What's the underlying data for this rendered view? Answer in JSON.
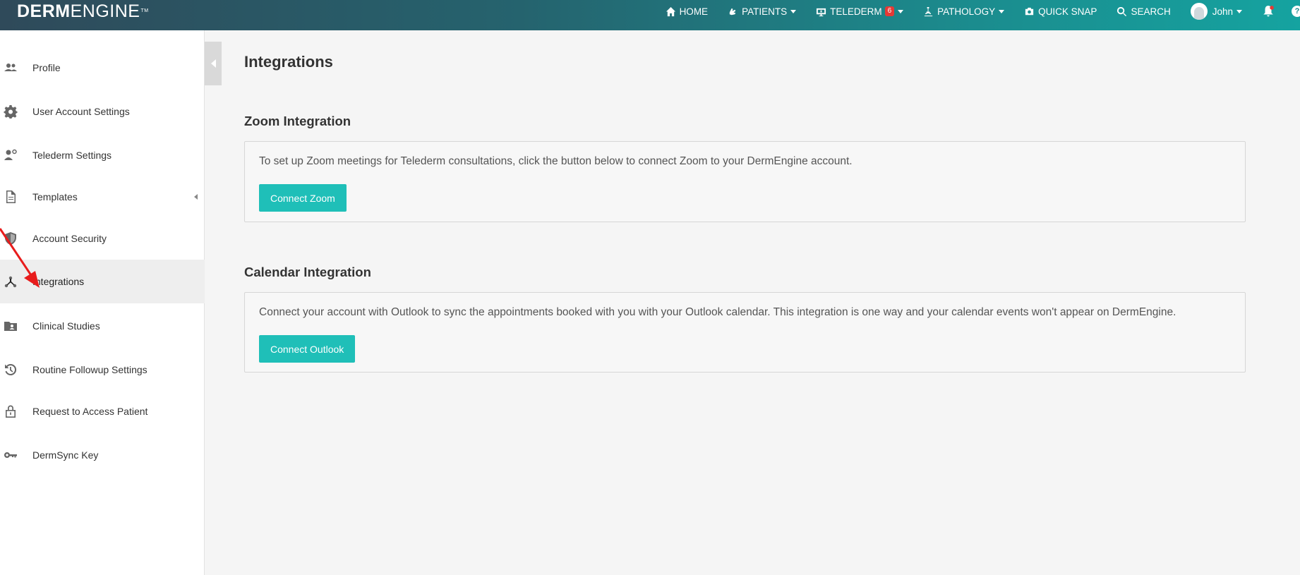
{
  "app": {
    "logo_bold": "DERM",
    "logo_light": "ENGINE",
    "logo_tm": "TM"
  },
  "nav": {
    "home": "HOME",
    "patients": "PATIENTS",
    "telederm": "TELEDERM",
    "telederm_badge": "6",
    "pathology": "PATHOLOGY",
    "quick_snap": "QUICK SNAP",
    "search": "SEARCH",
    "user": "John",
    "help": "?"
  },
  "sidebar": {
    "items": [
      {
        "label": "Profile",
        "icon": "people-icon"
      },
      {
        "label": "User Account Settings",
        "icon": "gear-icon"
      },
      {
        "label": "Telederm Settings",
        "icon": "user-cog-icon"
      },
      {
        "label": "Templates",
        "icon": "document-icon"
      },
      {
        "label": "Account Security",
        "icon": "shield-icon"
      },
      {
        "label": "Integrations",
        "icon": "integration-icon"
      },
      {
        "label": "Clinical Studies",
        "icon": "folder-user-icon"
      },
      {
        "label": "Routine Followup Settings",
        "icon": "history-icon"
      },
      {
        "label": "Request to Access Patient",
        "icon": "lock-icon"
      },
      {
        "label": "DermSync Key",
        "icon": "key-icon"
      }
    ],
    "active": "Integrations"
  },
  "main": {
    "title": "Integrations",
    "zoom": {
      "title": "Zoom Integration",
      "description": "To set up Zoom meetings for Telederm consultations, click the button below to connect Zoom to your DermEngine account.",
      "button": "Connect Zoom"
    },
    "calendar": {
      "title": "Calendar Integration",
      "description": "Connect your account with Outlook to sync the appointments booked with you with your Outlook calendar. This integration is one way and your calendar events won't appear on DermEngine.",
      "button": "Connect Outlook"
    }
  },
  "colors": {
    "accent": "#1fbfb8",
    "annotation": "#e81c1c",
    "badge": "#e53935"
  }
}
